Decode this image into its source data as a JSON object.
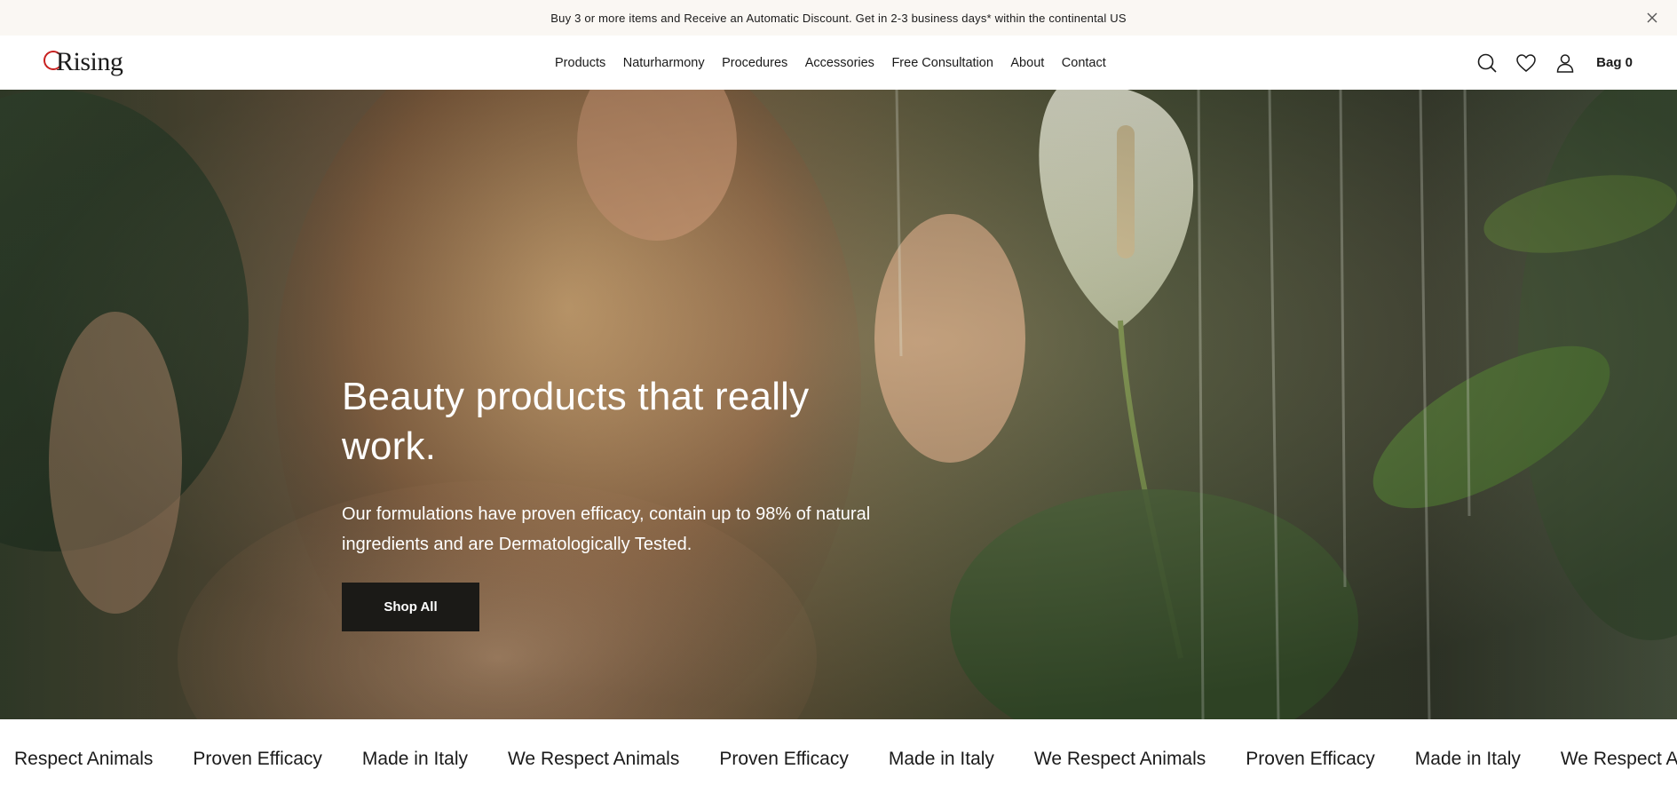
{
  "announcement": {
    "text": "Buy 3 or more items and Receive an Automatic Discount. Get in 2-3 business days* within the continental US",
    "close_icon": "close-icon"
  },
  "header": {
    "logo_text": "Rising",
    "logo_accent_color": "#c8201f",
    "nav": [
      {
        "label": "Products"
      },
      {
        "label": "Naturharmony"
      },
      {
        "label": "Procedures"
      },
      {
        "label": "Accessories"
      },
      {
        "label": "Free Consultation"
      },
      {
        "label": "About"
      },
      {
        "label": "Contact"
      }
    ],
    "icons": [
      "search-icon",
      "heart-icon",
      "user-icon"
    ],
    "bag_label": "Bag 0"
  },
  "hero": {
    "title": "Beauty products that really work.",
    "subtitle": "Our formulations have proven efficacy, contain up to 98% of natural ingredients and are Dermatologically Tested.",
    "cta_label": "Shop All",
    "cta_color": "#1b1a17"
  },
  "marquee": {
    "items": [
      "Respect Animals",
      "Proven Efficacy",
      "Made in Italy",
      "We Respect Animals",
      "Proven Efficacy",
      "Made in Italy",
      "We Respect Animals",
      "Proven Efficacy",
      "Made in Italy",
      "We Respect An"
    ]
  }
}
